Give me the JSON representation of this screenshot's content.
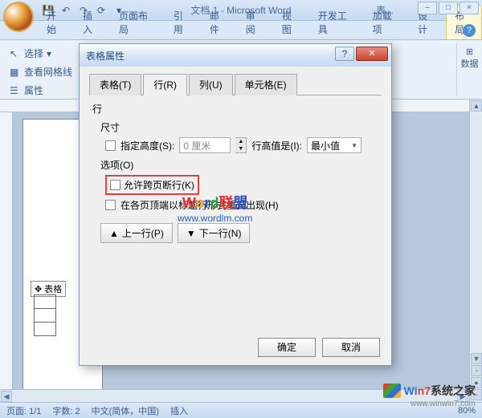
{
  "titlebar": {
    "doc_title": "文档 1 - Microsoft Word",
    "context_label": "表..."
  },
  "qat_icons": [
    "save-icon",
    "undo-icon",
    "redo-icon",
    "repeat-icon",
    "down-icon"
  ],
  "win_controls": {
    "min": "–",
    "max": "□",
    "close": "×"
  },
  "ribbon_tabs": [
    "开始",
    "插入",
    "页面布局",
    "引用",
    "邮件",
    "审阅",
    "视图",
    "开发工具",
    "加载项",
    "设计",
    "布局"
  ],
  "ribbon_active_index": 10,
  "ribbon_left": {
    "select": "选择",
    "gridlines": "查看网格线",
    "properties": "属性"
  },
  "ribbon_right": {
    "data": "数据"
  },
  "dialog": {
    "title": "表格属性",
    "tabs": [
      "表格(T)",
      "行(R)",
      "列(U)",
      "单元格(E)"
    ],
    "active_tab_index": 1,
    "section_row": "行",
    "section_size": "尺寸",
    "specify_height": "指定高度(S):",
    "height_value": "0 厘米",
    "row_height_is": "行高值是(I):",
    "row_height_mode": "最小值",
    "section_options": "选项(O)",
    "allow_break": "允许跨页断行(K)",
    "repeat_header": "在各页顶端以标题行形式重复出现(H)",
    "prev_row": "上一行(P)",
    "next_row": "下一行(N)",
    "ok": "确定",
    "cancel": "取消"
  },
  "doc": {
    "table_label": "表格"
  },
  "watermark": {
    "line1_prefix": "W",
    "line1_rest": "rd联盟",
    "line2": "www.wordlm.com"
  },
  "statusbar": {
    "page": "页面: 1/1",
    "words": "字数: 2",
    "lang": "中文(简体，中国)",
    "insert": "插入",
    "zoom": "80%"
  },
  "corner": {
    "brand": "Win7系统之家",
    "url": "www.winwin7.com"
  }
}
